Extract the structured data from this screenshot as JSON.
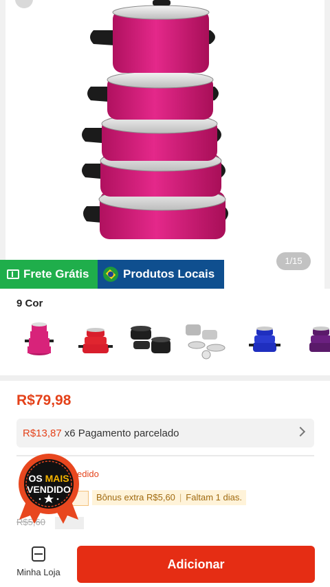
{
  "gallery": {
    "page_counter": "1/15",
    "badges": {
      "free_shipping": "Frete Grátis",
      "local_products": "Produtos Locais"
    }
  },
  "variants": {
    "title": "9 Cor",
    "swatches": [
      {
        "name": "pink-pot-set",
        "color": "#d8237a"
      },
      {
        "name": "red-pot-set",
        "color": "#d81e2c"
      },
      {
        "name": "black-pot-set",
        "color": "#1e1e1e"
      },
      {
        "name": "steel-pot-set",
        "color": "#b9b9b9"
      },
      {
        "name": "blue-pot-set",
        "color": "#1f2fbf"
      },
      {
        "name": "purple-pot-set",
        "color": "#5a1a6a"
      }
    ]
  },
  "price": {
    "current": "R$79,98",
    "installment_amount": "R$13,87",
    "installment_text": "x6 Pagamento parcelado"
  },
  "promo": {
    "red_text": "edido",
    "bonus_text": "Bônus extra R$5,60",
    "time_left": "Faltam 1 dias.",
    "faded_price": "R$5,60"
  },
  "seal": {
    "line1_a": "OS ",
    "line1_b": "MAIS",
    "line2": "VENDIDO"
  },
  "bottom_bar": {
    "store_label": "Minha Loja",
    "add_button": "Adicionar"
  },
  "colors": {
    "accent": "#e52d14",
    "price_red": "#e4421a",
    "frete_green": "#1fae4b",
    "local_blue": "#0f4f8f"
  }
}
